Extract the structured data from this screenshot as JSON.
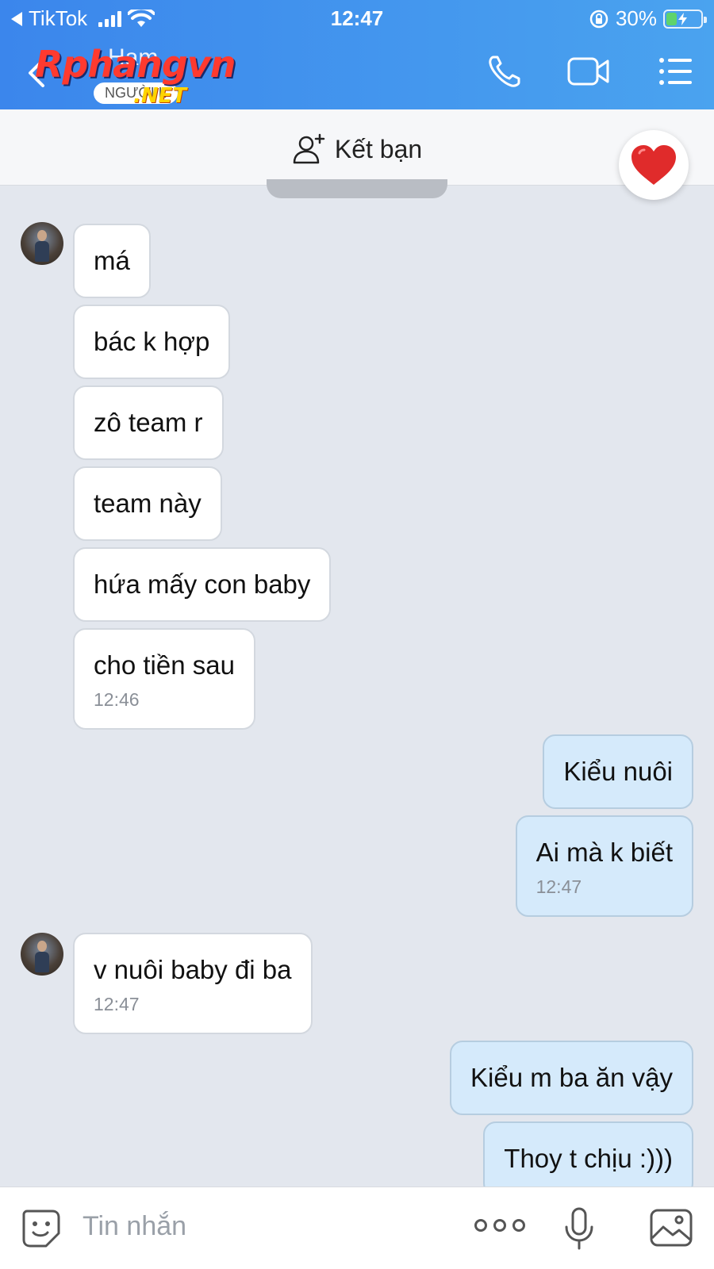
{
  "status_bar": {
    "back_app": "TikTok",
    "time": "12:47",
    "battery": "30%",
    "battery_level": 0.3
  },
  "header": {
    "contact_name": "Ham",
    "contact_status": "NGƯỜI L",
    "watermark_brand": "Rphangvn",
    "watermark_suffix": ".NET",
    "icons": [
      "back-icon",
      "phone-icon",
      "video-call-icon",
      "menu-list-icon"
    ]
  },
  "friend_bar": {
    "label": "Kết bạn",
    "icon": "add-friend-icon"
  },
  "heart_button": {
    "icon": "heart-icon",
    "color": "#e02b2b"
  },
  "messages": [
    {
      "dir": "in",
      "text": "má"
    },
    {
      "dir": "in",
      "text": "bác k hợp"
    },
    {
      "dir": "in",
      "text": "zô team r"
    },
    {
      "dir": "in",
      "text": "team này"
    },
    {
      "dir": "in",
      "text": "hứa mấy con baby"
    },
    {
      "dir": "in",
      "text": "cho tiền sau",
      "time": "12:46"
    },
    {
      "dir": "out",
      "text": "Kiểu nuôi"
    },
    {
      "dir": "out",
      "text": "Ai mà k biết",
      "time": "12:47"
    },
    {
      "dir": "in",
      "text": "v nuôi baby đi ba",
      "time": "12:47"
    },
    {
      "dir": "out",
      "text": "Kiểu m ba ăn vậy"
    },
    {
      "dir": "out",
      "text": "Thoy t chịu :)))"
    }
  ],
  "input_bar": {
    "placeholder": "Tin nhắn",
    "icons": [
      "sticker-icon",
      "more-icon",
      "microphone-icon",
      "image-icon"
    ]
  },
  "colors": {
    "header_start": "#3b86ec",
    "header_end": "#4aa3ef",
    "chat_background": "#e3e7ee",
    "incoming_bubble": "#ffffff",
    "outgoing_bubble": "#d5eafb"
  }
}
